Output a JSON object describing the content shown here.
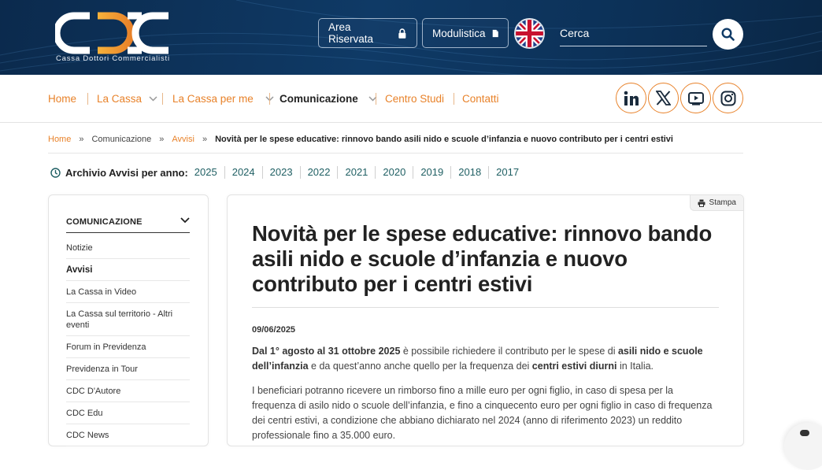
{
  "header": {
    "logo_tagline": "Cassa Dottori Commercialisti",
    "area_riservata_label": "Area Riservata",
    "modulistica_label": "Modulistica",
    "search_placeholder": "Cerca",
    "colors": {
      "primary": "#0f3a66",
      "accent": "#e8822a"
    }
  },
  "nav": {
    "items": [
      {
        "label": "Home"
      },
      {
        "label": "La Cassa"
      },
      {
        "label": "La Cassa per me"
      },
      {
        "label": "Comunicazione"
      },
      {
        "label": "Centro Studi"
      },
      {
        "label": "Contatti"
      }
    ],
    "social": [
      "linkedin-icon",
      "x-icon",
      "youtube-icon",
      "instagram-icon"
    ]
  },
  "breadcrumb": {
    "items": [
      "Home",
      "Comunicazione",
      "Avvisi"
    ],
    "current": "Novità per le spese educative: rinnovo bando asili nido e scuole d’infanzia e nuovo contributo per i centri estivi",
    "separator": "»"
  },
  "archive": {
    "label": "Archivio Avvisi per anno:",
    "years": [
      "2025",
      "2024",
      "2023",
      "2022",
      "2021",
      "2020",
      "2019",
      "2018",
      "2017"
    ]
  },
  "sidebar": {
    "title": "COMUNICAZIONE",
    "items": [
      "Notizie",
      "Avvisi",
      "La Cassa in Video",
      "La Cassa sul territorio - Altri eventi",
      "Forum in Previdenza",
      "Previdenza in Tour",
      "CDC D'Autore",
      "CDC Edu",
      "CDC News"
    ]
  },
  "article": {
    "print_label": "Stampa",
    "title": "Novità per le spese educative: rinnovo bando asili nido e scuole d’infanzia e nuovo contributo per i centri estivi",
    "date": "09/06/2025",
    "p1": {
      "b1": "Dal 1° agosto al 31 ottobre 2025",
      "t1": " è possibile richiedere il contributo per le spese di ",
      "b2": "asili nido e scuole dell’infanzia",
      "t2": " e da quest’anno anche quello per la frequenza dei ",
      "b3": "centri estivi diurni",
      "t3": " in Italia."
    },
    "p2": "I beneficiari potranno ricevere un rimborso fino a mille euro per ogni figlio, in caso di spesa per la frequenza di asilo nido o scuole dell’infanzia, e fino a cinquecento euro per ogni figlio in caso di frequenza dei centri estivi, a condizione che abbiano dichiarato nel 2024 (anno di riferimento 2023) un reddito professionale fino a 35.000 euro."
  }
}
